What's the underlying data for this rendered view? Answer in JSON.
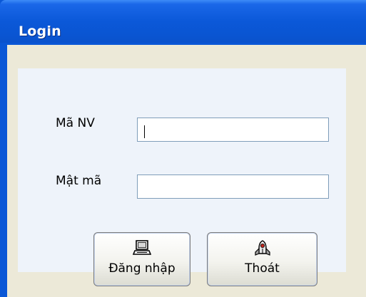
{
  "window": {
    "title": "Login"
  },
  "form": {
    "employee_id_label": "Mã NV",
    "employee_id_value": "",
    "password_label": "Mật mã",
    "password_value": ""
  },
  "buttons": {
    "login_label": "Đăng nhập",
    "exit_label": "Thoát"
  },
  "icons": {
    "login": "computer-icon",
    "exit": "rocket-icon"
  },
  "colors": {
    "titlebar": "#0a57d6",
    "client_background": "#ece9d8",
    "panel_background": "#eef3fa"
  }
}
